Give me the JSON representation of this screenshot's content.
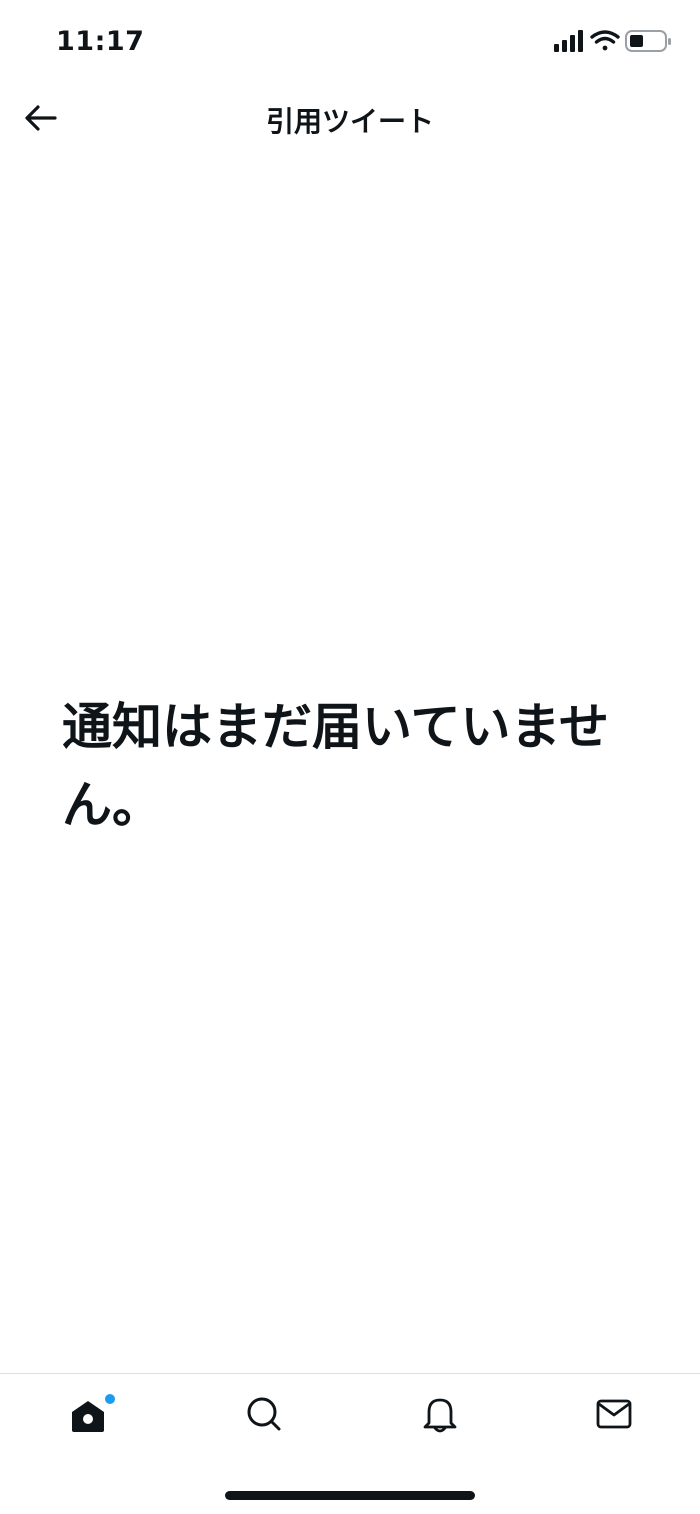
{
  "status_bar": {
    "time": "11:17",
    "icons": [
      "signal-icon",
      "wifi-icon",
      "battery-icon"
    ]
  },
  "header": {
    "back_icon": "back-arrow-icon",
    "title": "引用ツイート"
  },
  "empty_state": {
    "message": "通知はまだ届いていません。"
  },
  "tab_bar": {
    "tabs": [
      {
        "icon": "home-icon",
        "active": true,
        "has_dot": true
      },
      {
        "icon": "search-icon",
        "active": false
      },
      {
        "icon": "bell-icon",
        "active": false
      },
      {
        "icon": "mail-icon",
        "active": false
      }
    ]
  },
  "colors": {
    "text": "#0f1419",
    "accent": "#1d9bf0",
    "divider": "#dcdfe2",
    "background": "#ffffff"
  }
}
